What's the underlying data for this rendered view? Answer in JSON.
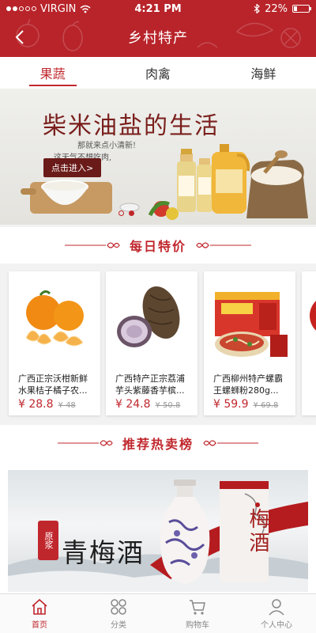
{
  "status": {
    "carrier": "VIRGIN",
    "time": "4:21 PM",
    "battery": "22%",
    "battery_level": 0.22
  },
  "header": {
    "title": "乡村特产"
  },
  "tabs": [
    {
      "label": "果蔬",
      "active": true
    },
    {
      "label": "肉禽",
      "active": false
    },
    {
      "label": "海鲜",
      "active": false
    }
  ],
  "banner": {
    "title": "柴米油盐的生活",
    "sub_line1": "那就来点小清新!",
    "sub_line2": "这天气不想吃肉,",
    "cta_label": "点击进入>",
    "dots": [
      false,
      true
    ]
  },
  "daily_deals": {
    "title": "每日特价",
    "items": [
      {
        "name": "广西正宗沃柑新鲜水果桔子橘子农...",
        "price": "¥ 28.8",
        "old_price": "¥ 48"
      },
      {
        "name": "广西特产正宗荔浦芋头紫藤香芋槟...",
        "price": "¥ 24.8",
        "old_price": "¥ 50.8"
      },
      {
        "name": "广西柳州特产螺霸王螺蛳粉280g...",
        "price": "¥ 59.9",
        "old_price": "¥ 69.8"
      }
    ]
  },
  "hot_list": {
    "title": "推荐热卖榜",
    "banner_name": "青梅酒",
    "banner_seal": "原浆",
    "box_label": "梅酒"
  },
  "tabbar": [
    {
      "label": "首页",
      "icon": "home-icon",
      "active": true
    },
    {
      "label": "分类",
      "icon": "category-icon",
      "active": false
    },
    {
      "label": "购物车",
      "icon": "cart-icon",
      "active": false
    },
    {
      "label": "个人中心",
      "icon": "profile-icon",
      "active": false
    }
  ],
  "colors": {
    "brand_red": "#b8242a",
    "accent_red": "#c0272d"
  }
}
